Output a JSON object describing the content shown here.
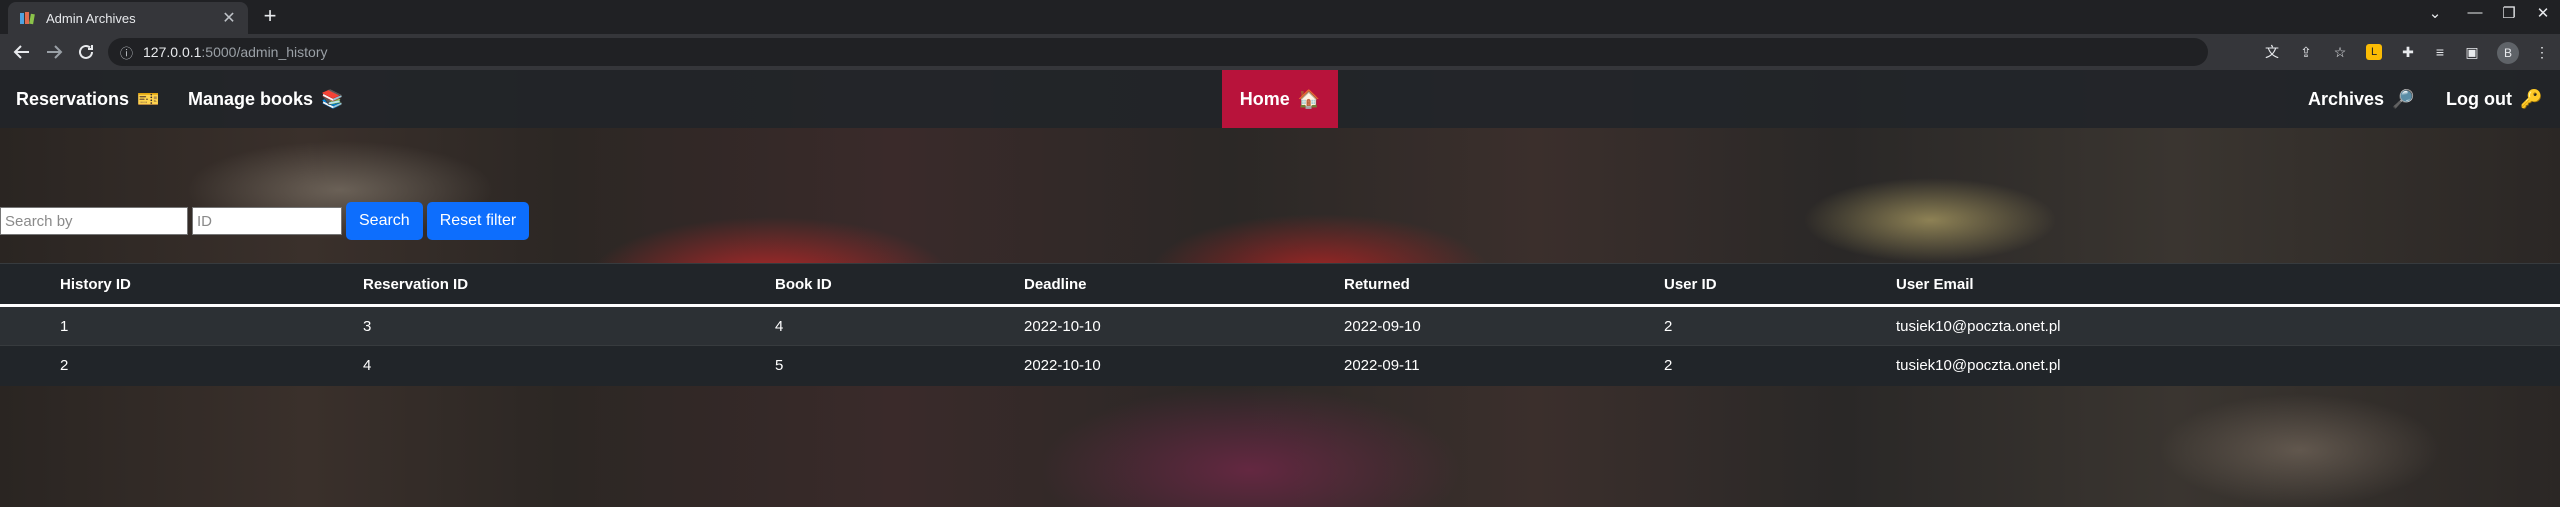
{
  "browser": {
    "tab_title": "Admin Archives",
    "tab_close": "✕",
    "new_tab": "+",
    "url_host": "127.0.0.1",
    "url_path": ":5000/admin_history",
    "window_controls": [
      "—",
      "❐",
      "✕"
    ],
    "chevron": "⌄",
    "profile_initial": "B"
  },
  "nav": {
    "reservations": "Reservations",
    "reservations_emoji": "🎫",
    "manage_books": "Manage books",
    "manage_books_emoji": "📚",
    "home": "Home",
    "home_emoji": "🏠",
    "archives": "Archives",
    "archives_emoji": "🔎",
    "logout": "Log out",
    "logout_emoji": "🔑"
  },
  "filter": {
    "search_by_placeholder": "Search by",
    "id_placeholder": "ID",
    "search_button": "Search",
    "reset_button": "Reset filter"
  },
  "table": {
    "headers": [
      "History ID",
      "Reservation ID",
      "Book ID",
      "Deadline",
      "Returned",
      "User ID",
      "User Email"
    ],
    "rows": [
      [
        "1",
        "3",
        "4",
        "2022-10-10",
        "2022-09-10",
        "2",
        "tusiek10@poczta.onet.pl"
      ],
      [
        "2",
        "4",
        "5",
        "2022-10-10",
        "2022-09-11",
        "2",
        "tusiek10@poczta.onet.pl"
      ]
    ]
  }
}
